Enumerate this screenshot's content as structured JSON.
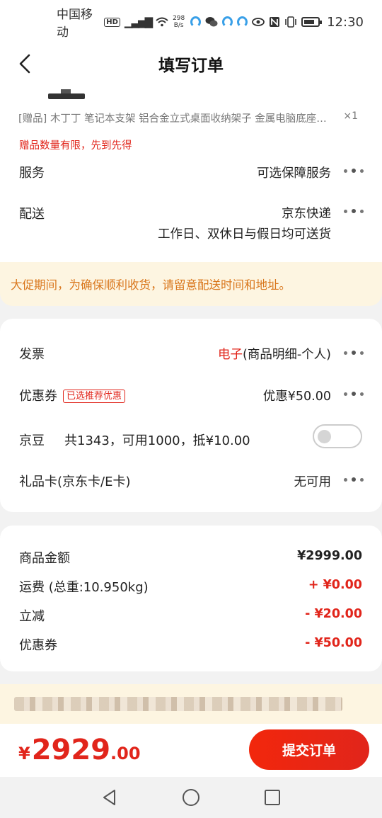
{
  "status_bar": {
    "carrier": "中国移动",
    "hd": "HD",
    "signal": "4G",
    "net_speed_value": "298",
    "net_speed_unit": "B/s",
    "time": "12:30",
    "icons": [
      "hd-icon",
      "signal-icon",
      "wifi-icon",
      "app-icon",
      "wechat-icon",
      "app-icon",
      "app-icon",
      "eye-icon",
      "nfc-icon",
      "vibrate-icon",
      "battery-icon"
    ]
  },
  "header": {
    "title": "填写订单",
    "back_icon": "chevron-left-icon"
  },
  "gift": {
    "tag": "[赠品]",
    "name": "木丁丁 笔记本支架 铝合金立式桌面收纳架子 金属电脑底座托...",
    "qty": "×1",
    "note": "赠品数量有限，先到先得"
  },
  "service": {
    "label": "服务",
    "value": "可选保障服务"
  },
  "delivery": {
    "label": "配送",
    "value": "京东快递",
    "sub": "工作日、双休日与假日均可送货"
  },
  "promo_notice": "大促期间，为确保顺利收货，请留意配送时间和地址。",
  "invoice": {
    "label": "发票",
    "value_highlight": "电子",
    "value_rest": "(商品明细-个人)"
  },
  "coupon": {
    "label": "优惠券",
    "badge": "已选推荐优惠",
    "value": "优惠¥50.00"
  },
  "jingdou": {
    "label": "京豆",
    "desc": "共1343，可用1000，抵¥10.00",
    "enabled": false
  },
  "giftcard": {
    "label": "礼品卡(京东卡/E卡)",
    "value": "无可用"
  },
  "summary": {
    "goods_label": "商品金额",
    "goods_value": "¥2999.00",
    "shipping_label": "运费 (总重:10.950kg)",
    "shipping_value": "+ ¥0.00",
    "discount_label": "立减",
    "discount_value": "- ¥20.00",
    "coupon_label": "优惠券",
    "coupon_value": "- ¥50.00"
  },
  "footer": {
    "currency": "¥",
    "total_int": "2929",
    "total_dec": ".00",
    "submit_label": "提交订单"
  },
  "colors": {
    "accent_red": "#e1251b",
    "promo_text": "#d9761c",
    "promo_bg": "#fdf5e1"
  }
}
